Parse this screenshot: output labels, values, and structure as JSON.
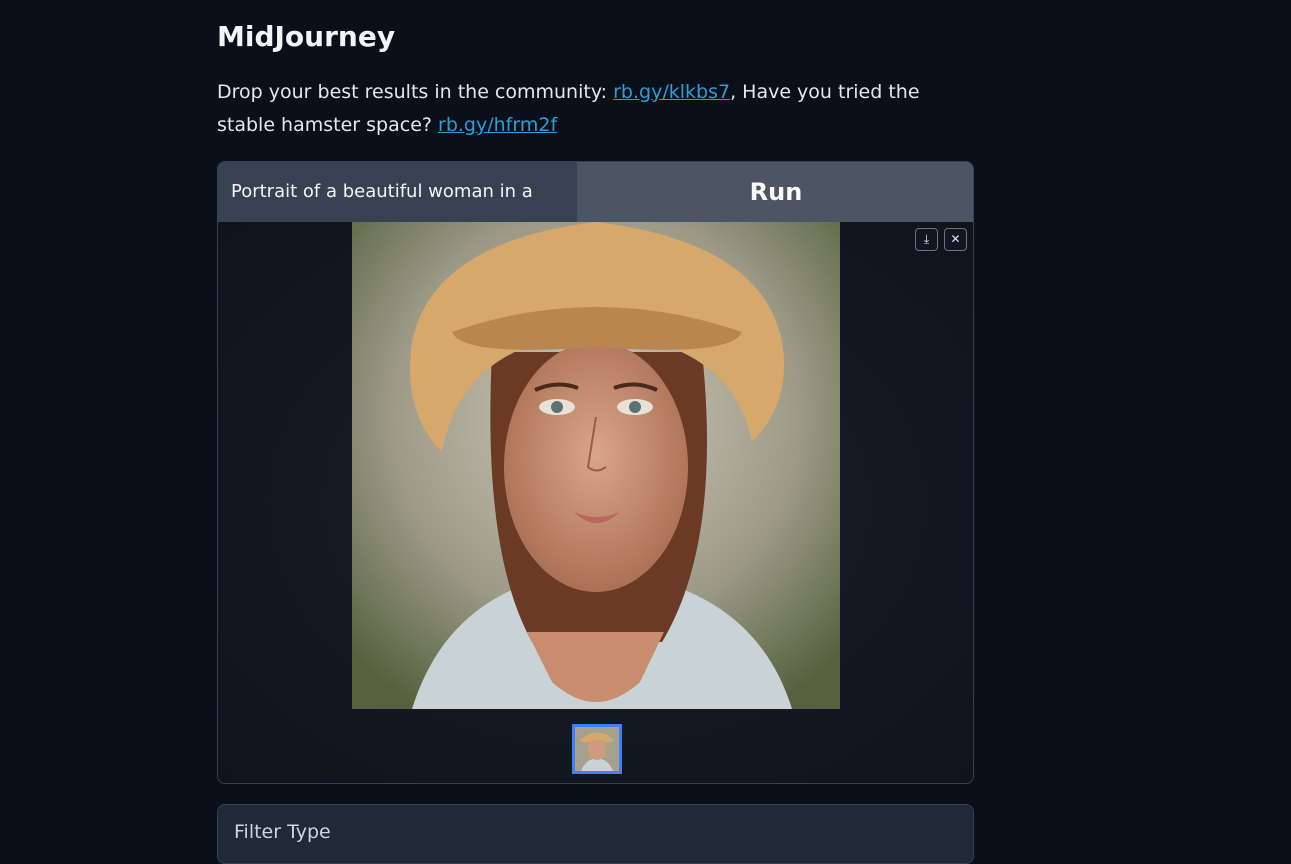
{
  "header": {
    "title": "MidJourney"
  },
  "description": {
    "text_before": "Drop your best results in the community: ",
    "link1": "rb.gy/klkbs7",
    "text_middle": ", Have you tried the stable hamster space? ",
    "link2": "rb.gy/hfrm2f"
  },
  "prompt": {
    "value": "Portrait of a beautiful woman in a"
  },
  "run_label": "Run",
  "gallery": {
    "download_icon": "download-icon",
    "close_icon": "close-icon",
    "selected_index": 0
  },
  "filter": {
    "label": "Filter Type"
  },
  "colors": {
    "background": "#0b0f19",
    "link": "#2a9fd6",
    "accent": "#3b82f6"
  }
}
